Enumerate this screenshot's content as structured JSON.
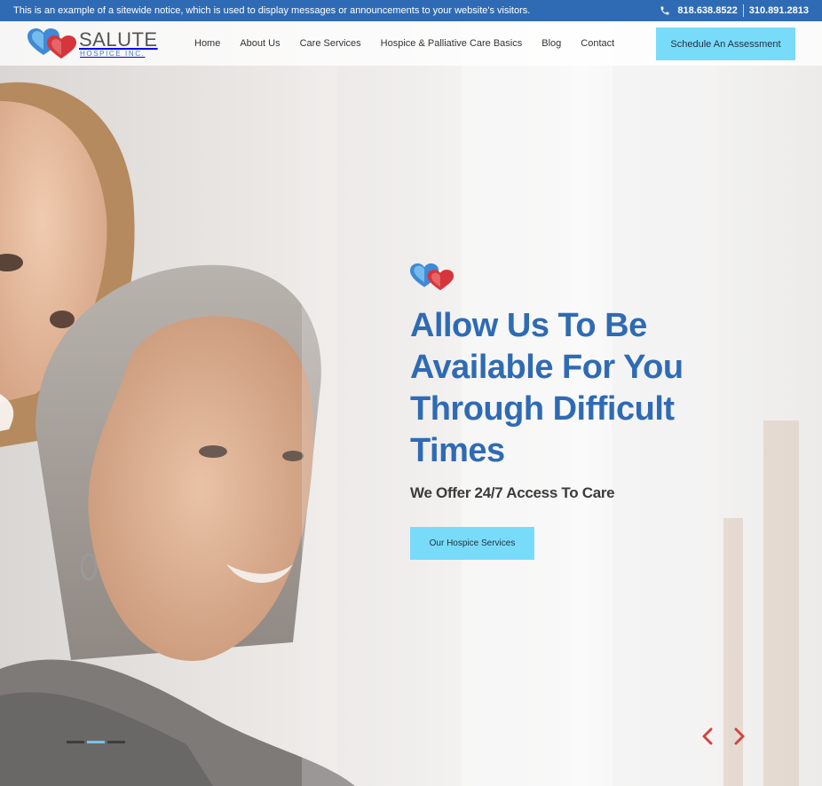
{
  "notice": {
    "text": "This is an example of a sitewide notice, which is used to display messages or announcements to your website's visitors.",
    "phone_1": "818.638.8522",
    "phone_2": "310.891.2813",
    "phone_icon": "phone-icon"
  },
  "header": {
    "logo_name": "SALUTE",
    "logo_sub": "HOSPICE INC.",
    "nav": [
      {
        "label": "Home"
      },
      {
        "label": "About Us"
      },
      {
        "label": "Care Services"
      },
      {
        "label": "Hospice & Palliative Care Basics"
      },
      {
        "label": "Blog"
      },
      {
        "label": "Contact"
      }
    ],
    "cta_label": "Schedule An Assessment"
  },
  "hero": {
    "title": "Allow Us To Be Available For You Through Difficult Times",
    "subtitle": "We Offer 24/7 Access To Care",
    "button_label": "Our Hospice Services"
  },
  "slider": {
    "active_index": 1,
    "slide_count": 3,
    "prev_icon": "chevron-left-icon",
    "next_icon": "chevron-right-icon"
  },
  "colors": {
    "brand_blue": "#2f6bb4",
    "cta_cyan": "#79dbfa",
    "arrow_red": "#d0453f"
  }
}
